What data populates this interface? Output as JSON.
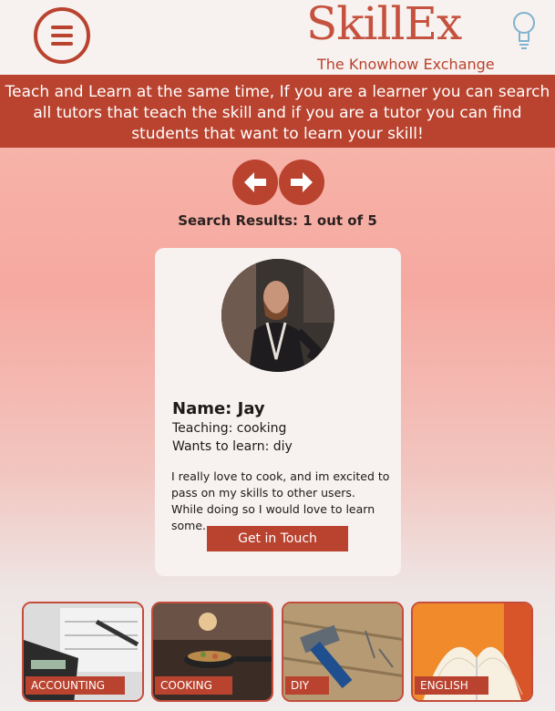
{
  "header": {
    "logo_text": "SkillEx",
    "tagline": "The Knowhow Exchange"
  },
  "banner": {
    "text": "Teach and Learn at the same time, If you are a learner you can search all tutors that teach the skill and if you are a tutor you can find students that want to learn your skill!"
  },
  "navigation": {
    "prev_icon": "arrow-left-icon",
    "next_icon": "arrow-right-icon"
  },
  "results": {
    "text": "Search Results: 1 out of 5"
  },
  "card": {
    "name": "Name: Jay",
    "teaching": "Teaching: cooking",
    "wants": "Wants to learn: diy",
    "bio": "I really love to cook, and im excited to pass on my skills to other users. While doing so I would love to learn some...",
    "button": "Get in Touch"
  },
  "categories": [
    {
      "label": "ACCOUNTING"
    },
    {
      "label": "COOKING"
    },
    {
      "label": "DIY"
    },
    {
      "label": "ENGLISH"
    }
  ],
  "colors": {
    "accent": "#b9432f",
    "card_bg": "#f7f1ef"
  }
}
